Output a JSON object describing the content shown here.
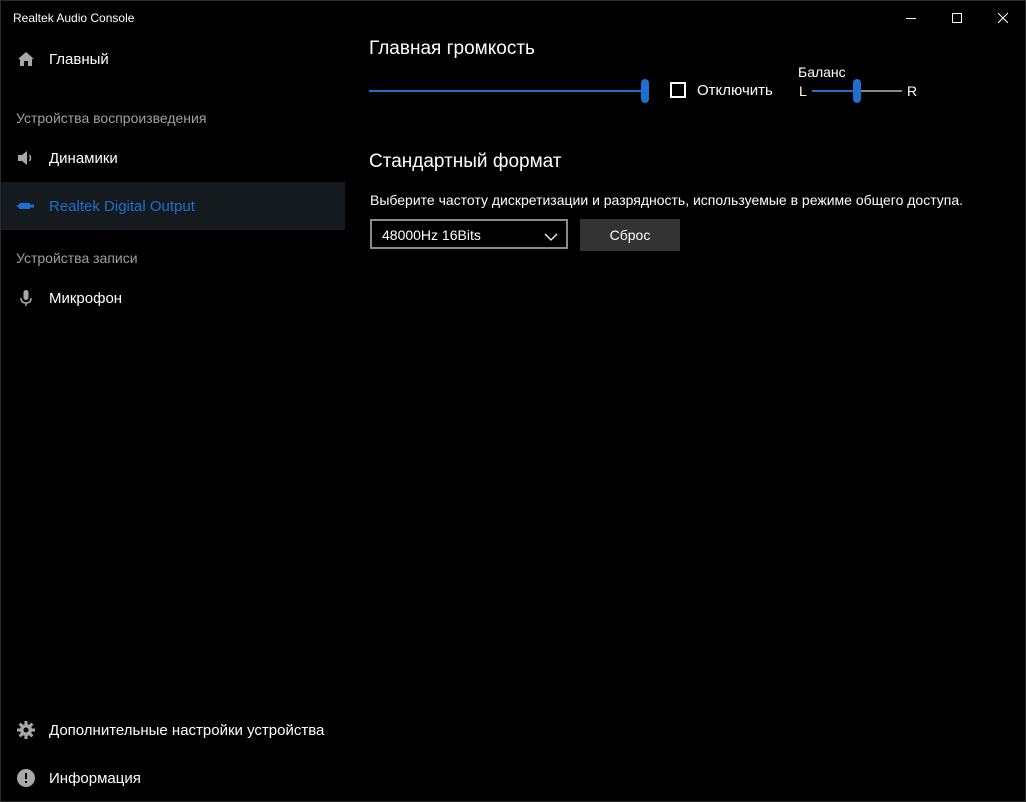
{
  "window": {
    "title": "Realtek Audio Console"
  },
  "sidebar": {
    "main_item": {
      "label": "Главный",
      "icon": "home-icon"
    },
    "playback_header": "Устройства воспроизведения",
    "playback_items": [
      {
        "label": "Динамики",
        "icon": "speaker-icon",
        "selected": false
      },
      {
        "label": "Realtek Digital Output",
        "icon": "digital-output-icon",
        "selected": true
      }
    ],
    "recording_header": "Устройства записи",
    "recording_items": [
      {
        "label": "Микрофон",
        "icon": "microphone-icon"
      }
    ],
    "advanced_settings": {
      "label": "Дополнительные настройки устройства",
      "icon": "gear-icon"
    },
    "info": {
      "label": "Информация",
      "icon": "info-icon"
    }
  },
  "main": {
    "master_volume": {
      "title": "Главная громкость",
      "volume_percent": 100,
      "mute_label": "Отключить",
      "muted": false,
      "balance_label": "Баланс",
      "balance_left": "L",
      "balance_right": "R",
      "balance_value": 0
    },
    "default_format": {
      "title": "Стандартный формат",
      "description": "Выберите частоту дискретизации и разрядность, используемые в режиме общего доступа.",
      "selected_format": "48000Hz 16Bits",
      "reset_label": "Сброс"
    }
  },
  "colors": {
    "accent": "#1f6fcf",
    "background": "#000000",
    "selected_bg": "#151a1e",
    "secondary_text": "#a0a0a0"
  }
}
